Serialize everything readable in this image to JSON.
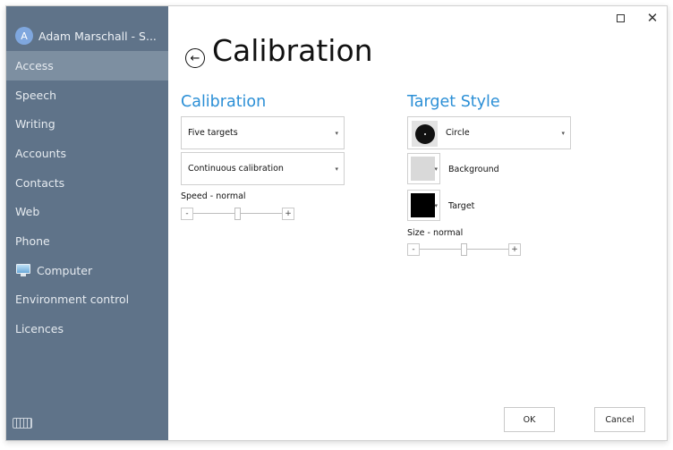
{
  "window": {
    "title": "Calibration"
  },
  "user": {
    "initial": "A",
    "name": "Adam Marschall - S..."
  },
  "nav": [
    {
      "label": "Access"
    },
    {
      "label": "Speech"
    },
    {
      "label": "Writing"
    },
    {
      "label": "Accounts"
    },
    {
      "label": "Contacts"
    },
    {
      "label": "Web"
    },
    {
      "label": "Phone"
    },
    {
      "label": "Computer",
      "icon": "monitor-icon"
    },
    {
      "label": "Environment control"
    },
    {
      "label": "Licences"
    }
  ],
  "active_nav": "Access",
  "page": {
    "title": "Calibration"
  },
  "calibration": {
    "heading": "Calibration",
    "targets_dropdown": "Five targets",
    "mode_dropdown": "Continuous calibration",
    "speed_label": "Speed - normal",
    "speed_level": 0.5,
    "minus": "-",
    "plus": "+"
  },
  "target_style": {
    "heading": "Target Style",
    "shape_dropdown": "Circle",
    "background_label": "Background",
    "background_color": "#d9d9d9",
    "target_label": "Target",
    "target_color": "#000000",
    "size_label": "Size - normal",
    "size_level": 0.5,
    "minus": "-",
    "plus": "+"
  },
  "buttons": {
    "ok": "OK",
    "cancel": "Cancel"
  },
  "colors": {
    "sidebar": "#5f7389",
    "active": "#7d8fa1",
    "accent": "#2b8fd6"
  }
}
